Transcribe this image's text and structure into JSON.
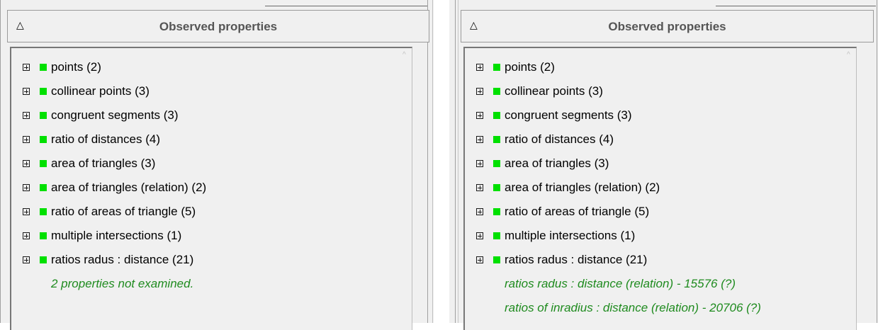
{
  "panels": [
    {
      "header": {
        "collapse_glyph": "△",
        "title": "Observed properties"
      },
      "items": [
        {
          "label": "points (2)"
        },
        {
          "label": "collinear points (3)"
        },
        {
          "label": "congruent segments (3)"
        },
        {
          "label": "ratio of distances (4)"
        },
        {
          "label": "area of triangles (3)"
        },
        {
          "label": "area of triangles (relation) (2)"
        },
        {
          "label": "ratio of areas of triangle (5)"
        },
        {
          "label": "multiple intersections (1)"
        },
        {
          "label": "ratios radus : distance (21)"
        }
      ],
      "notes": [
        "2 properties not examined."
      ]
    },
    {
      "header": {
        "collapse_glyph": "△",
        "title": "Observed properties"
      },
      "items": [
        {
          "label": "points (2)"
        },
        {
          "label": "collinear points (3)"
        },
        {
          "label": "congruent segments (3)"
        },
        {
          "label": "ratio of distances (4)"
        },
        {
          "label": "area of triangles (3)"
        },
        {
          "label": "area of triangles (relation) (2)"
        },
        {
          "label": "ratio of areas of triangle (5)"
        },
        {
          "label": "multiple intersections (1)"
        },
        {
          "label": "ratios radus : distance (21)"
        }
      ],
      "notes": [
        "ratios radus : distance (relation) - 15576 (?)",
        "ratios of inradius : distance (relation) - 20706 (?)"
      ]
    }
  ],
  "colors": {
    "status_green": "#00e000",
    "note_green": "#1f8b1f",
    "header_text": "#555555"
  },
  "icons": {
    "expander": "plus-box-icon",
    "status": "green-square-icon",
    "collapse": "triangle-up-icon",
    "scroll": "scroll-up-arrow-icon"
  }
}
